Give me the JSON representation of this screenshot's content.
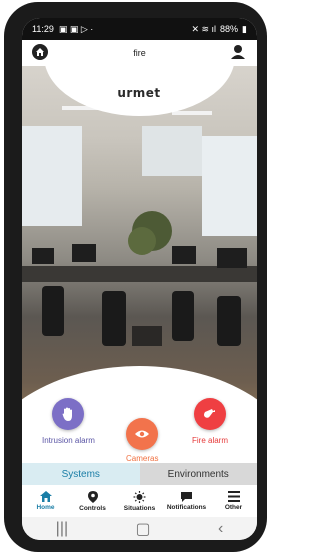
{
  "status_bar": {
    "time": "11:29",
    "battery": "88%"
  },
  "header": {
    "title": "fire"
  },
  "logo": {
    "text": "urmet"
  },
  "controls": {
    "intrusion_label": "Intrusion alarm",
    "cameras_label": "Cameras",
    "fire_label": "Fire alarm"
  },
  "tabs": [
    {
      "label": "Systems",
      "active": true
    },
    {
      "label": "Environments",
      "active": false
    }
  ],
  "bottom_nav": [
    {
      "label": "Home",
      "icon": "home-icon"
    },
    {
      "label": "Controls",
      "icon": "location-pin-icon"
    },
    {
      "label": "Situations",
      "icon": "sun-icon"
    },
    {
      "label": "Notifications",
      "icon": "chat-bubble-icon"
    },
    {
      "label": "Other",
      "icon": "menu-icon"
    }
  ],
  "colors": {
    "accent": "#1b7ea6",
    "intrusion": "#7c6fc6",
    "cameras": "#f2734c",
    "fire": "#ef3f42"
  }
}
